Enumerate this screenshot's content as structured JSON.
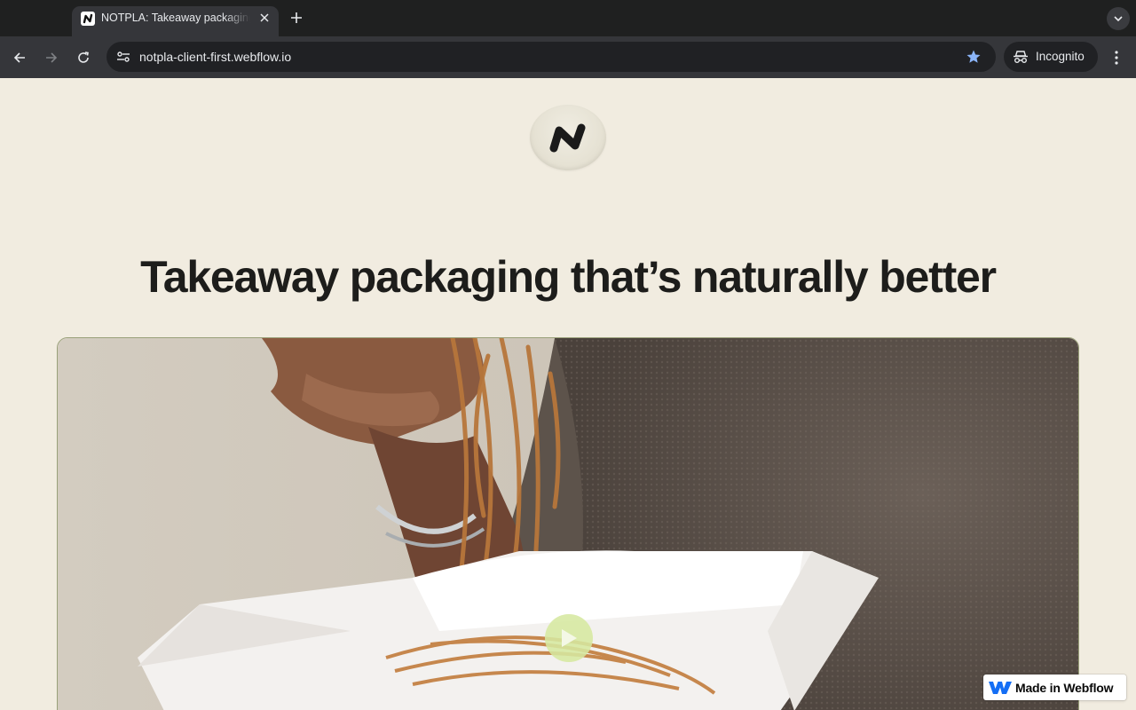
{
  "browser": {
    "tab": {
      "title": "NOTPLA: Takeaway packaging that's naturally better",
      "favicon": "notpla-logo-icon"
    },
    "new_tab_icon": "plus-icon",
    "tab_list_icon": "chevron-down-icon",
    "toolbar": {
      "back_icon": "back-arrow-icon",
      "forward_icon": "forward-arrow-icon",
      "reload_icon": "reload-icon",
      "site_info_icon": "tune-icon",
      "url": "notpla-client-first.webflow.io",
      "bookmark_icon": "star-icon",
      "bookmarked": true,
      "profile_label": "Incognito",
      "profile_icon": "incognito-icon",
      "menu_icon": "kebab-menu-icon"
    },
    "colors": {
      "tabstrip": "#1f2020",
      "toolbar": "#35363a",
      "star": "#8ab4f8"
    }
  },
  "page": {
    "logo_icon": "notpla-logo-icon",
    "headline": "Takeaway packaging that’s naturally better",
    "hero_video": {
      "play_icon": "play-icon",
      "play_button_color": "#d6e8a0"
    },
    "background_color": "#f1ece0"
  },
  "badge": {
    "label": "Made in Webflow",
    "icon": "webflow-logo-icon"
  }
}
